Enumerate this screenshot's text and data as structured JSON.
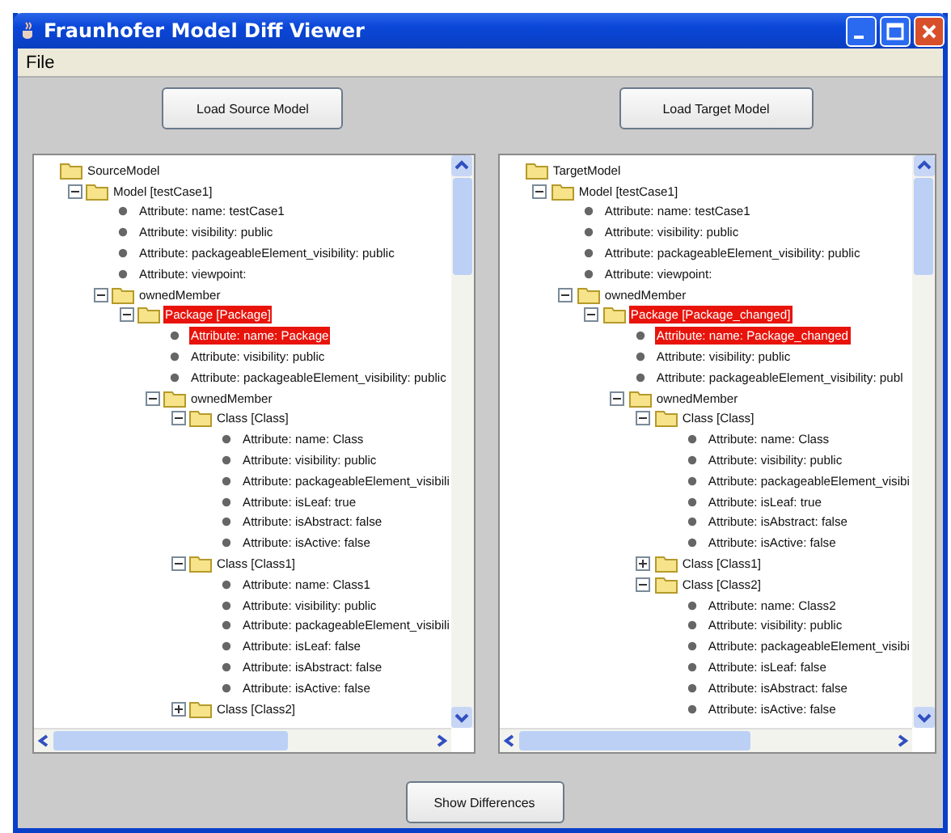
{
  "window": {
    "title": "Fraunhofer Model Diff Viewer"
  },
  "menu": [
    "File"
  ],
  "buttons": {
    "load_source": "Load Source Model",
    "load_target": "Load Target Model",
    "show_differences": "Show Differences"
  },
  "trees": [
    {
      "kind": "root",
      "label": "SourceModel",
      "highlighted": false,
      "children": [
        {
          "kind": "folder",
          "label": "Model [testCase1]",
          "expanded": true,
          "highlighted": false,
          "children": [
            {
              "kind": "attribute",
              "label": "Attribute: name: testCase1",
              "highlighted": false
            },
            {
              "kind": "attribute",
              "label": "Attribute: visibility: public",
              "highlighted": false
            },
            {
              "kind": "attribute",
              "label": "Attribute: packageableElement_visibility: public",
              "highlighted": false
            },
            {
              "kind": "attribute",
              "label": "Attribute: viewpoint:",
              "highlighted": false
            },
            {
              "kind": "folder",
              "label": "ownedMember",
              "expanded": true,
              "highlighted": false,
              "children": [
                {
                  "kind": "folder",
                  "label": "Package [Package]",
                  "expanded": true,
                  "highlighted": true,
                  "children": [
                    {
                      "kind": "attribute",
                      "label": "Attribute: name: Package",
                      "highlighted": true
                    },
                    {
                      "kind": "attribute",
                      "label": "Attribute: visibility: public",
                      "highlighted": false
                    },
                    {
                      "kind": "attribute",
                      "label": "Attribute: packageableElement_visibility: public",
                      "highlighted": false
                    },
                    {
                      "kind": "folder",
                      "label": "ownedMember",
                      "expanded": true,
                      "highlighted": false,
                      "children": [
                        {
                          "kind": "folder",
                          "label": "Class [Class]",
                          "expanded": true,
                          "highlighted": false,
                          "children": [
                            {
                              "kind": "attribute",
                              "label": "Attribute: name: Class",
                              "highlighted": false
                            },
                            {
                              "kind": "attribute",
                              "label": "Attribute: visibility: public",
                              "highlighted": false
                            },
                            {
                              "kind": "attribute",
                              "label": "Attribute: packageableElement_visibili",
                              "highlighted": false
                            },
                            {
                              "kind": "attribute",
                              "label": "Attribute: isLeaf: true",
                              "highlighted": false
                            },
                            {
                              "kind": "attribute",
                              "label": "Attribute: isAbstract: false",
                              "highlighted": false
                            },
                            {
                              "kind": "attribute",
                              "label": "Attribute: isActive: false",
                              "highlighted": false
                            }
                          ]
                        },
                        {
                          "kind": "folder",
                          "label": "Class [Class1]",
                          "expanded": true,
                          "highlighted": false,
                          "children": [
                            {
                              "kind": "attribute",
                              "label": "Attribute: name: Class1",
                              "highlighted": false
                            },
                            {
                              "kind": "attribute",
                              "label": "Attribute: visibility: public",
                              "highlighted": false
                            },
                            {
                              "kind": "attribute",
                              "label": "Attribute: packageableElement_visibili",
                              "highlighted": false
                            },
                            {
                              "kind": "attribute",
                              "label": "Attribute: isLeaf: false",
                              "highlighted": false
                            },
                            {
                              "kind": "attribute",
                              "label": "Attribute: isAbstract: false",
                              "highlighted": false
                            },
                            {
                              "kind": "attribute",
                              "label": "Attribute: isActive: false",
                              "highlighted": false
                            }
                          ]
                        },
                        {
                          "kind": "folder",
                          "label": "Class [Class2]",
                          "expanded": false,
                          "highlighted": false
                        }
                      ]
                    }
                  ]
                }
              ]
            }
          ]
        }
      ]
    },
    {
      "kind": "root",
      "label": "TargetModel",
      "highlighted": false,
      "children": [
        {
          "kind": "folder",
          "label": "Model [testCase1]",
          "expanded": true,
          "highlighted": false,
          "children": [
            {
              "kind": "attribute",
              "label": "Attribute: name: testCase1",
              "highlighted": false
            },
            {
              "kind": "attribute",
              "label": "Attribute: visibility: public",
              "highlighted": false
            },
            {
              "kind": "attribute",
              "label": "Attribute: packageableElement_visibility: public",
              "highlighted": false
            },
            {
              "kind": "attribute",
              "label": "Attribute: viewpoint:",
              "highlighted": false
            },
            {
              "kind": "folder",
              "label": "ownedMember",
              "expanded": true,
              "highlighted": false,
              "children": [
                {
                  "kind": "folder",
                  "label": "Package [Package_changed]",
                  "expanded": true,
                  "highlighted": true,
                  "children": [
                    {
                      "kind": "attribute",
                      "label": "Attribute: name: Package_changed",
                      "highlighted": true
                    },
                    {
                      "kind": "attribute",
                      "label": "Attribute: visibility: public",
                      "highlighted": false
                    },
                    {
                      "kind": "attribute",
                      "label": "Attribute: packageableElement_visibility: publ",
                      "highlighted": false
                    },
                    {
                      "kind": "folder",
                      "label": "ownedMember",
                      "expanded": true,
                      "highlighted": false,
                      "children": [
                        {
                          "kind": "folder",
                          "label": "Class [Class]",
                          "expanded": true,
                          "highlighted": false,
                          "children": [
                            {
                              "kind": "attribute",
                              "label": "Attribute: name: Class",
                              "highlighted": false
                            },
                            {
                              "kind": "attribute",
                              "label": "Attribute: visibility: public",
                              "highlighted": false
                            },
                            {
                              "kind": "attribute",
                              "label": "Attribute: packageableElement_visibi",
                              "highlighted": false
                            },
                            {
                              "kind": "attribute",
                              "label": "Attribute: isLeaf: true",
                              "highlighted": false
                            },
                            {
                              "kind": "attribute",
                              "label": "Attribute: isAbstract: false",
                              "highlighted": false
                            },
                            {
                              "kind": "attribute",
                              "label": "Attribute: isActive: false",
                              "highlighted": false
                            }
                          ]
                        },
                        {
                          "kind": "folder",
                          "label": "Class [Class1]",
                          "expanded": false,
                          "highlighted": false
                        },
                        {
                          "kind": "folder",
                          "label": "Class [Class2]",
                          "expanded": true,
                          "highlighted": false,
                          "children": [
                            {
                              "kind": "attribute",
                              "label": "Attribute: name: Class2",
                              "highlighted": false
                            },
                            {
                              "kind": "attribute",
                              "label": "Attribute: visibility: public",
                              "highlighted": false
                            },
                            {
                              "kind": "attribute",
                              "label": "Attribute: packageableElement_visibi",
                              "highlighted": false
                            },
                            {
                              "kind": "attribute",
                              "label": "Attribute: isLeaf: false",
                              "highlighted": false
                            },
                            {
                              "kind": "attribute",
                              "label": "Attribute: isAbstract: false",
                              "highlighted": false
                            },
                            {
                              "kind": "attribute",
                              "label": "Attribute: isActive: false",
                              "highlighted": false
                            }
                          ]
                        }
                      ]
                    }
                  ]
                }
              ]
            }
          ]
        }
      ]
    }
  ]
}
